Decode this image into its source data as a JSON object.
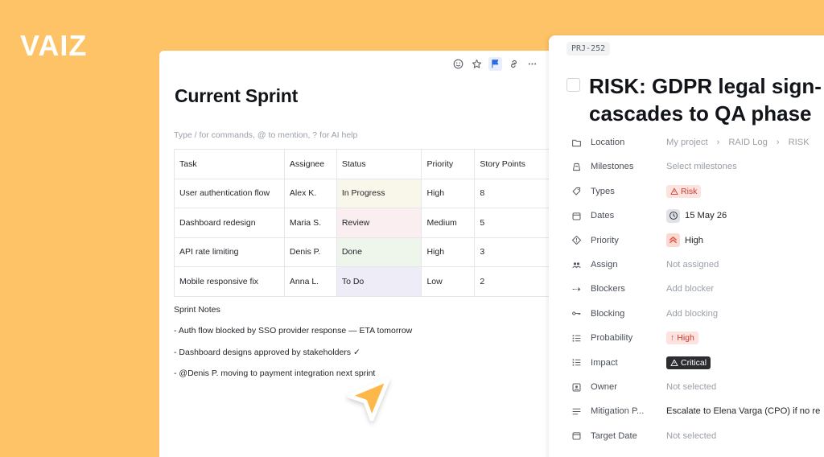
{
  "brand": {
    "logo_text": "VAIZ"
  },
  "doc": {
    "title": "Current Sprint",
    "placeholder": "Type / for commands, @ to mention, ? for AI help",
    "toolbar": [
      "emoji-icon",
      "star-icon",
      "flag-icon",
      "link-icon",
      "more-icon"
    ],
    "table": {
      "headers": [
        "Task",
        "Assignee",
        "Status",
        "Priority",
        "Story Points"
      ],
      "rows": [
        [
          "User authentication flow",
          "Alex K.",
          "In Progress",
          "High",
          "8"
        ],
        [
          "Dashboard redesign",
          "Maria S.",
          "Review",
          "Medium",
          "5"
        ],
        [
          "API rate limiting",
          "Denis P.",
          "Done",
          "High",
          "3"
        ],
        [
          "Mobile responsive fix",
          "Anna L.",
          "To Do",
          "Low",
          "2"
        ]
      ]
    },
    "notes": [
      "Sprint Notes",
      "- Auth flow blocked by SSO provider response — ETA tomorrow",
      "- Dashboard designs approved by stakeholders ✓",
      "- @Denis P. moving to payment integration next sprint"
    ]
  },
  "task": {
    "id": "PRJ-252",
    "title_line1": "RISK: GDPR legal sign-",
    "title_line2": "cascades to QA phase",
    "props": {
      "location": {
        "label": "Location",
        "path": [
          "My project",
          "RAID Log",
          "RISK"
        ]
      },
      "milestones": {
        "label": "Milestones",
        "value": "Select milestones"
      },
      "types": {
        "label": "Types",
        "value": "Risk"
      },
      "dates": {
        "label": "Dates",
        "value": "15 May 26"
      },
      "priority": {
        "label": "Priority",
        "value": "High"
      },
      "assign": {
        "label": "Assign",
        "value": "Not assigned"
      },
      "blockers": {
        "label": "Blockers",
        "value": "Add blocker"
      },
      "blocking": {
        "label": "Blocking",
        "value": "Add blocking"
      },
      "probability": {
        "label": "Probability",
        "value": "High"
      },
      "impact": {
        "label": "Impact",
        "value": "Critical"
      },
      "owner": {
        "label": "Owner",
        "value": "Not selected"
      },
      "mitigation": {
        "label": "Mitigation P...",
        "value": "Escalate to Elena Varga (CPO) if no re"
      },
      "target_date": {
        "label": "Target Date",
        "value": "Not selected"
      }
    }
  },
  "colors": {
    "background": "#FEC366",
    "accent": "#FDB84A",
    "risk": "#D23B2A",
    "critical": "#2B2D31"
  }
}
